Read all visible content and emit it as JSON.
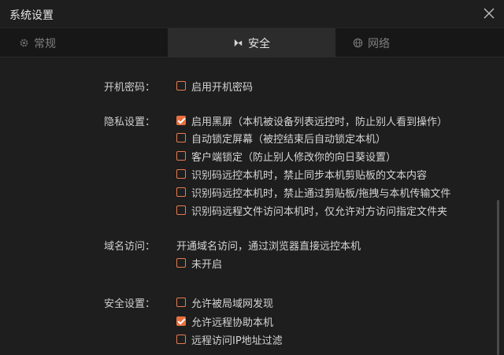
{
  "window": {
    "title": "系统设置",
    "close_icon": "close-icon"
  },
  "tabs": [
    {
      "label": "常规",
      "icon": "gear-icon",
      "active": false
    },
    {
      "label": "安全",
      "icon": "security-icon",
      "active": true
    },
    {
      "label": "网络",
      "icon": "globe-icon",
      "active": false
    }
  ],
  "sections": {
    "boot_password": {
      "label": "开机密码：",
      "options": [
        {
          "label": "启用开机密码",
          "checked": false
        }
      ]
    },
    "privacy": {
      "label": "隐私设置：",
      "options": [
        {
          "label": "启用黑屏（本机被设备列表远控时，防止别人看到操作）",
          "checked": true
        },
        {
          "label": "自动锁定屏幕（被控结束后自动锁定本机）",
          "checked": false
        },
        {
          "label": "客户端锁定（防止别人修改你的向日葵设置）",
          "checked": false
        },
        {
          "label": "识别码远控本机时，禁止同步本机剪贴板的文本内容",
          "checked": false
        },
        {
          "label": "识别码远控本机时，禁止通过剪贴板/拖拽与本机传输文件",
          "checked": false
        },
        {
          "label": "识别码远程文件访问本机时，仅允许对方访问指定文件夹",
          "checked": false
        }
      ]
    },
    "domain_access": {
      "label": "域名访问：",
      "description": "开通域名访问，通过浏览器直接远控本机",
      "options": [
        {
          "label": "未开启",
          "checked": false
        }
      ]
    },
    "security": {
      "label": "安全设置：",
      "options": [
        {
          "label": "允许被局域网发现",
          "checked": false
        },
        {
          "label": "允许远程协助本机",
          "checked": true
        },
        {
          "label": "远程访问IP地址过滤",
          "checked": false
        }
      ]
    }
  },
  "colors": {
    "accent": "#e8703e",
    "background": "#1e1e1e",
    "tab_active": "#2c2c2c"
  }
}
